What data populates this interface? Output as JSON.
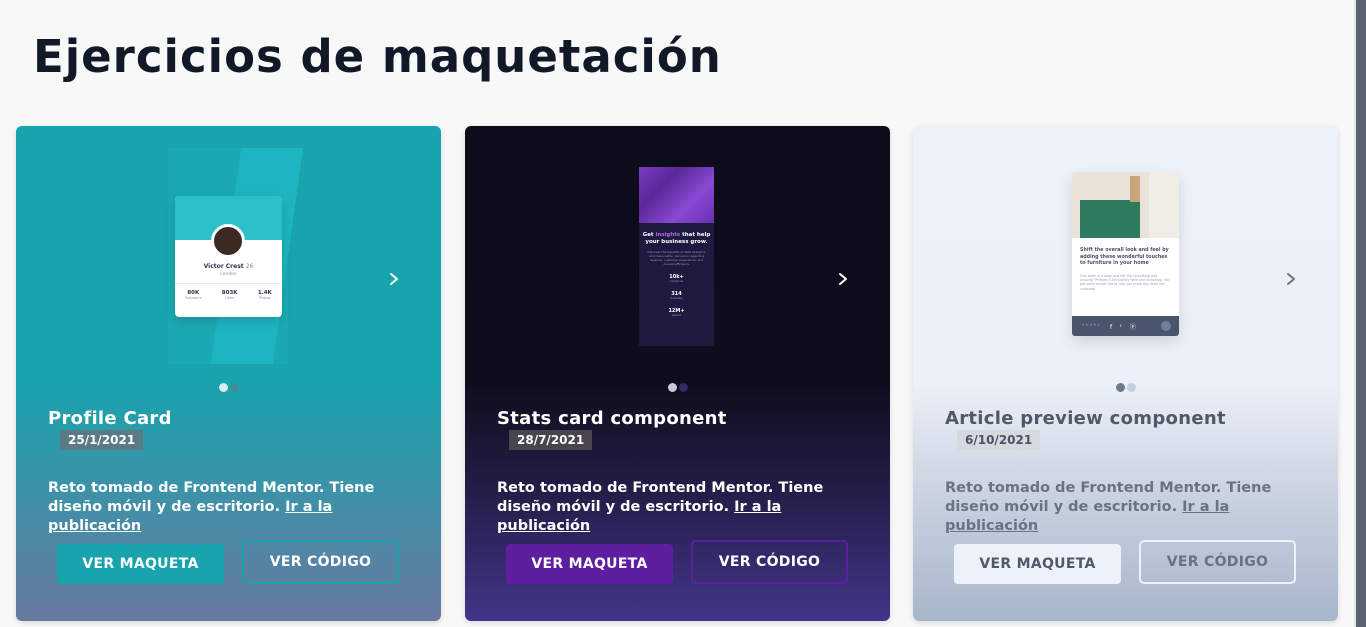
{
  "page": {
    "title": "Ejercicios de maquetación"
  },
  "cards": [
    {
      "title": "Profile Card",
      "date": "25/1/2021",
      "description": "Reto tomado de Frontend Mentor. Tiene diseño móvil y de escritorio.",
      "link_label": "Ir a la publicación",
      "primary_button": "VER MAQUETA",
      "secondary_button": "VER CÓDIGO",
      "active_slide": 1,
      "slide_count": 2,
      "accent_color": "#18a3ad",
      "preview": {
        "name": "Victor Crest",
        "age": "26",
        "city": "London",
        "stats": [
          {
            "value": "80K",
            "label": "Followers"
          },
          {
            "value": "803K",
            "label": "Likes"
          },
          {
            "value": "1.4K",
            "label": "Photos"
          }
        ]
      }
    },
    {
      "title": "Stats card component",
      "date": "28/7/2021",
      "description": "Reto tomado de Frontend Mentor. Tiene diseño móvil y de escritorio.",
      "link_label": "Ir a la publicación",
      "primary_button": "VER MAQUETA",
      "secondary_button": "VER CÓDIGO",
      "active_slide": 1,
      "slide_count": 2,
      "accent_color": "#5e1ea0",
      "preview": {
        "heading_start": "Get ",
        "heading_highlight": "insights",
        "heading_end": " that help your business grow.",
        "text": "Discover the benefits of data analytics and make better decisions regarding revenue, customer experience, and overall efficiency.",
        "stats": [
          {
            "value": "10k+",
            "label": "companies"
          },
          {
            "value": "314",
            "label": "templates"
          },
          {
            "value": "12M+",
            "label": "queries"
          }
        ]
      }
    },
    {
      "title": "Article preview component",
      "date": "6/10/2021",
      "description": "Reto tomado de Frontend Mentor. Tiene diseño móvil y de escritorio.",
      "link_label": "Ir a la publicación",
      "primary_button": "VER MAQUETA",
      "secondary_button": "VER CÓDIGO",
      "active_slide": 1,
      "slide_count": 2,
      "accent_color": "#edf1fa",
      "preview": {
        "heading": "Shift the overall look and feel by adding these wonderful touches to furniture in your home",
        "text": "Ever been in a room and felt like something was missing? Perhaps it felt slightly bare and uninviting. I've got some simple tips to help you make any room feel complete.",
        "share_label": "SHARE"
      }
    }
  ]
}
